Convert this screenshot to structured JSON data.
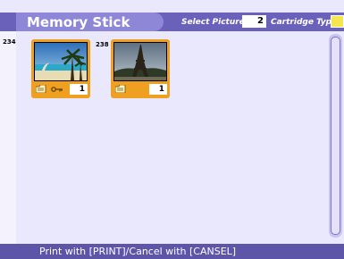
{
  "header": {
    "title": "Memory Stick",
    "select_label": "Select Pictures",
    "select_count": "2",
    "cartridge_label": "Cartridge Type",
    "cartridge_color": "#f3e64e"
  },
  "thumbnails": [
    {
      "number": "234",
      "image": "palm-beach",
      "icons": [
        "folder-icon",
        "key-icon"
      ],
      "quantity": "1"
    },
    {
      "number": "238",
      "image": "eiffel-tower",
      "icons": [
        "folder-icon"
      ],
      "quantity": "1"
    }
  ],
  "footer": {
    "instructions": "Print with [PRINT]/Cancel with [CANSEL]"
  },
  "colors": {
    "accent": "#6a62ba",
    "title_tab": "#8e86d6",
    "background": "#eae8fc",
    "selection_frame": "#f0a020"
  }
}
